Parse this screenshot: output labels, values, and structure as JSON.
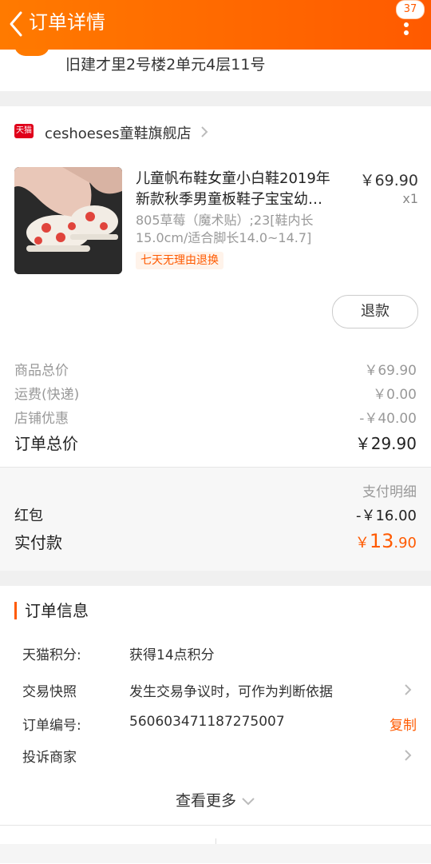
{
  "header": {
    "title": "订单详情",
    "badge": "37"
  },
  "address": {
    "line": "旧建才里2号楼2单元4层11号"
  },
  "shop": {
    "platform_tag": "天猫",
    "name": "ceshoeses童鞋旗舰店"
  },
  "product": {
    "title_line1": "儿童帆布鞋女童小白鞋2019年",
    "title_line2": "新款秋季男童板鞋子宝宝幼…",
    "price": "￥69.90",
    "qty": "x1",
    "sku_line1": "805草莓（魔术贴）;23[鞋内长",
    "sku_line2": "15.0cm/适合脚长14.0~14.7]",
    "tag": "七天无理由退换",
    "refund_label": "退款"
  },
  "summary": {
    "rows": [
      {
        "label": "商品总价",
        "value": "￥69.90"
      },
      {
        "label": "运费(快递)",
        "value": "￥0.00"
      },
      {
        "label": "店铺优惠",
        "value": "-￥40.00"
      }
    ],
    "total_label": "订单总价",
    "total_value": "￥29.90"
  },
  "payment": {
    "detail_label": "支付明细",
    "redpack_label": "红包",
    "redpack_value": "-￥16.00",
    "actual_label": "实付款",
    "actual_currency": "￥",
    "actual_int": "13",
    "actual_dec": ".90"
  },
  "order_info": {
    "title": "订单信息",
    "points_key": "天猫积分:",
    "points_val": "获得14点积分",
    "snapshot_key": "交易快照",
    "snapshot_val": "发生交易争议时，可作为判断依据",
    "order_no_key": "订单编号:",
    "order_no_val": "560603471187275007",
    "copy_label": "复制",
    "complain_key": "投诉商家",
    "view_more": "查看更多"
  },
  "colors": {
    "accent": "#ff5a00",
    "tmall": "#e0001b"
  }
}
